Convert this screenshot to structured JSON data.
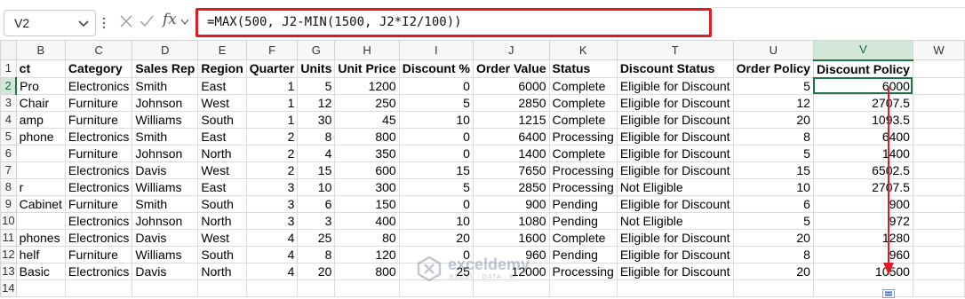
{
  "name_box": {
    "value": "V2"
  },
  "formula_bar": {
    "fx_label": "fx",
    "formula": "=MAX(500, J2-MIN(1500, J2*I2/100))"
  },
  "columns": [
    "B",
    "C",
    "D",
    "E",
    "F",
    "G",
    "H",
    "I",
    "J",
    "K",
    "T",
    "U",
    "V",
    "W"
  ],
  "selected_column": "V",
  "selected_row": 2,
  "rows": [
    {
      "n": "1",
      "cells": [
        "ct",
        "Category",
        "Sales Rep",
        "Region",
        "Quarter",
        "Units",
        "Unit Price",
        "Discount %",
        "Order Value",
        "Status",
        "Discount Status",
        "Order Policy",
        "Discount Policy",
        ""
      ]
    },
    {
      "n": "2",
      "cells": [
        " Pro",
        "Electronics",
        "Smith",
        "East",
        "1",
        "5",
        "1200",
        "0",
        "6000",
        "Complete",
        "Eligible for Discount",
        "5",
        "6000",
        ""
      ]
    },
    {
      "n": "3",
      "cells": [
        "Chair",
        "Furniture",
        "Johnson",
        "West",
        "1",
        "12",
        "250",
        "5",
        "2850",
        "Complete",
        "Eligible for Discount",
        "12",
        "2707.5",
        ""
      ]
    },
    {
      "n": "4",
      "cells": [
        "amp",
        "Furniture",
        "Williams",
        "South",
        "1",
        "30",
        "45",
        "10",
        "1215",
        "Complete",
        "Eligible for Discount",
        "20",
        "1093.5",
        ""
      ]
    },
    {
      "n": "5",
      "cells": [
        "phone",
        "Electronics",
        "Smith",
        "East",
        "2",
        "8",
        "800",
        "0",
        "6400",
        "Processing",
        "Eligible for Discount",
        "8",
        "6400",
        ""
      ]
    },
    {
      "n": "6",
      "cells": [
        "",
        "Furniture",
        "Johnson",
        "North",
        "2",
        "4",
        "350",
        "0",
        "1400",
        "Complete",
        "Eligible for Discount",
        "5",
        "1400",
        ""
      ]
    },
    {
      "n": "7",
      "cells": [
        "",
        "Electronics",
        "Davis",
        "West",
        "2",
        "15",
        "600",
        "15",
        "7650",
        "Processing",
        "Eligible for Discount",
        "15",
        "6502.5",
        ""
      ]
    },
    {
      "n": "8",
      "cells": [
        "r",
        "Electronics",
        "Williams",
        "East",
        "3",
        "10",
        "300",
        "5",
        "2850",
        "Processing",
        "Not Eligible",
        "10",
        "2707.5",
        ""
      ]
    },
    {
      "n": "9",
      "cells": [
        "Cabinet",
        "Furniture",
        "Smith",
        "South",
        "3",
        "6",
        "150",
        "0",
        "900",
        "Pending",
        "Eligible for Discount",
        "6",
        "900",
        ""
      ]
    },
    {
      "n": "10",
      "cells": [
        "",
        "Electronics",
        "Johnson",
        "North",
        "3",
        "3",
        "400",
        "10",
        "1080",
        "Pending",
        "Not Eligible",
        "5",
        "972",
        ""
      ]
    },
    {
      "n": "11",
      "cells": [
        "phones",
        "Electronics",
        "Davis",
        "West",
        "4",
        "25",
        "80",
        "20",
        "1600",
        "Complete",
        "Eligible for Discount",
        "20",
        "1280",
        ""
      ]
    },
    {
      "n": "12",
      "cells": [
        "helf",
        "Furniture",
        "Williams",
        "South",
        "4",
        "8",
        "120",
        "0",
        "960",
        "Pending",
        "Eligible for Discount",
        "8",
        "960",
        ""
      ]
    },
    {
      "n": "13",
      "cells": [
        " Basic",
        "Electronics",
        "Davis",
        "North",
        "4",
        "20",
        "800",
        "25",
        "12000",
        "Processing",
        "Eligible for Discount",
        "20",
        "10500",
        ""
      ]
    },
    {
      "n": "14",
      "cells": [
        "",
        "",
        "",
        "",
        "",
        "",
        "",
        "",
        "",
        "",
        "",
        "",
        "",
        ""
      ]
    }
  ],
  "watermark": {
    "name": "exceldemy",
    "tagline": "EXCEL · DATA · BI"
  },
  "colors": {
    "accent": "#217346",
    "formula_highlight": "#e01b24",
    "arrow": "#e01b24"
  }
}
